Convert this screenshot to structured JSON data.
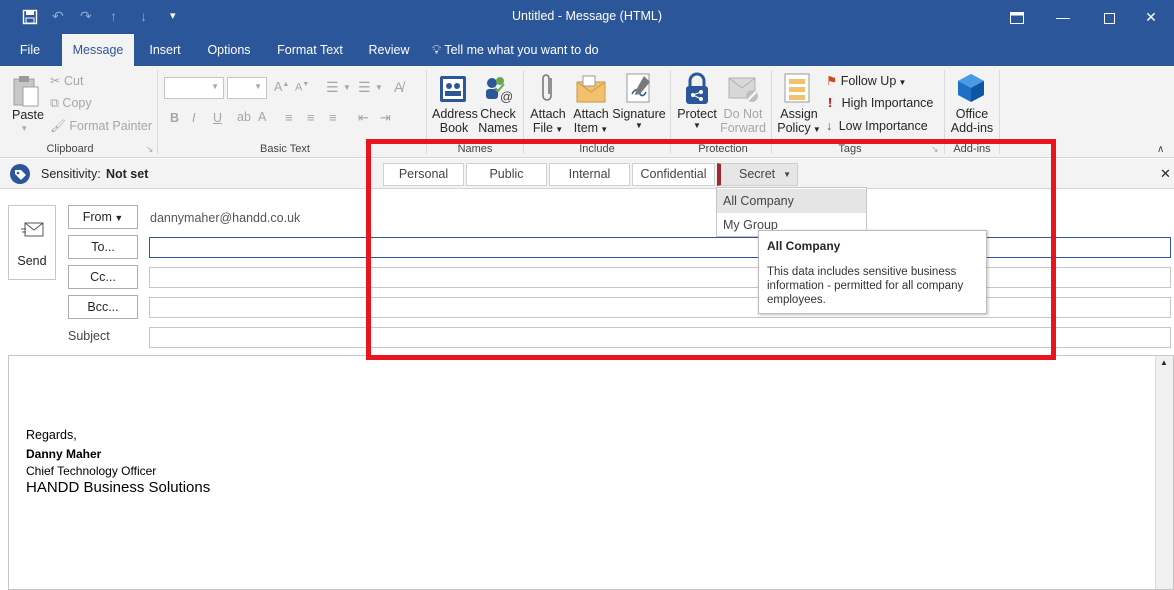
{
  "window": {
    "title": "Untitled  -  Message (HTML)"
  },
  "tabs": [
    {
      "label": "File"
    },
    {
      "label": "Message"
    },
    {
      "label": "Insert"
    },
    {
      "label": "Options"
    },
    {
      "label": "Format Text"
    },
    {
      "label": "Review"
    }
  ],
  "tell_me": "Tell me what you want to do",
  "ribbon": {
    "clipboard": {
      "label": "Clipboard",
      "paste": "Paste",
      "cut": "Cut",
      "copy": "Copy",
      "format_painter": "Format Painter"
    },
    "basic_text": {
      "label": "Basic Text"
    },
    "names": {
      "label": "Names",
      "address_book_1": "Address",
      "address_book_2": "Book",
      "check_names_1": "Check",
      "check_names_2": "Names"
    },
    "include": {
      "label": "Include",
      "attach_file_1": "Attach",
      "attach_file_2": "File",
      "attach_item_1": "Attach",
      "attach_item_2": "Item",
      "signature": "Signature"
    },
    "protection": {
      "label": "Protection",
      "protect": "Protect",
      "do_not_forward_1": "Do Not",
      "do_not_forward_2": "Forward"
    },
    "tags": {
      "label": "Tags",
      "assign_policy_1": "Assign",
      "assign_policy_2": "Policy",
      "follow_up": "Follow Up",
      "high_importance": "High Importance",
      "low_importance": "Low Importance"
    },
    "addins": {
      "label": "Add-ins",
      "office_addins_1": "Office",
      "office_addins_2": "Add-ins"
    }
  },
  "sensitivity": {
    "label": "Sensitivity:",
    "value": "Not set",
    "options": [
      "Personal",
      "Public",
      "Internal",
      "Confidential",
      "Secret"
    ]
  },
  "dropdown": {
    "items": [
      "All Company",
      "My Group"
    ],
    "tooltip_title": "All Company",
    "tooltip_text": "This data includes sensitive business information - permitted for all company employees."
  },
  "header": {
    "send": "Send",
    "from_label": "From",
    "from_value": "dannymaher@handd.co.uk",
    "to_label": "To...",
    "cc_label": "Cc...",
    "bcc_label": "Bcc...",
    "subject_label": "Subject"
  },
  "body": {
    "regards": "Regards,",
    "name": "Danny Maher",
    "role": "Chief Technology Officer",
    "company": "HANDD Business Solutions"
  },
  "colors": {
    "brand": "#2b579a",
    "highlight_box": "#e8141e",
    "secret_marker": "#a4262c"
  }
}
